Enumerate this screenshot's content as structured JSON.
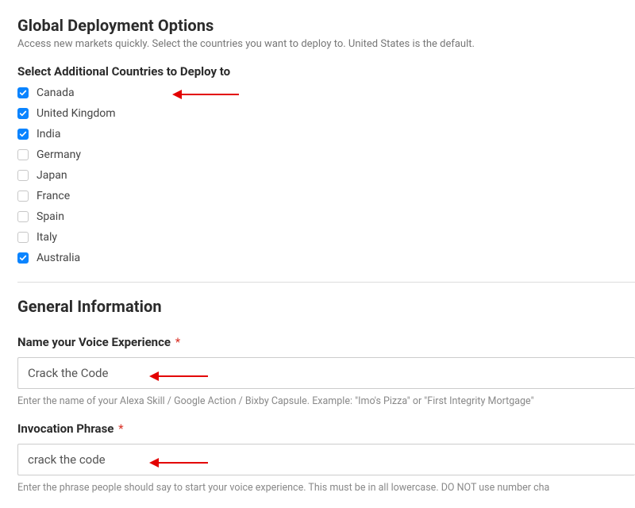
{
  "deployment": {
    "title": "Global Deployment Options",
    "desc": "Access new markets quickly. Select the countries you want to deploy to. United States is the default.",
    "sublabel": "Select Additional Countries to Deploy to",
    "countries": [
      {
        "name": "Canada",
        "checked": true
      },
      {
        "name": "United Kingdom",
        "checked": true
      },
      {
        "name": "India",
        "checked": true
      },
      {
        "name": "Germany",
        "checked": false
      },
      {
        "name": "Japan",
        "checked": false
      },
      {
        "name": "France",
        "checked": false
      },
      {
        "name": "Spain",
        "checked": false
      },
      {
        "name": "Italy",
        "checked": false
      },
      {
        "name": "Australia",
        "checked": true
      }
    ]
  },
  "general": {
    "title": "General Information",
    "name_field": {
      "label": "Name your Voice Experience",
      "value": "Crack the Code",
      "hint": "Enter the name of your Alexa Skill / Google Action / Bixby Capsule. Example: \"Imo's Pizza\" or \"First Integrity Mortgage\""
    },
    "invocation_field": {
      "label": "Invocation Phrase",
      "value": "crack the code",
      "hint": "Enter the phrase people should say to start your voice experience. This must be in all lowercase. DO NOT use number cha"
    }
  }
}
